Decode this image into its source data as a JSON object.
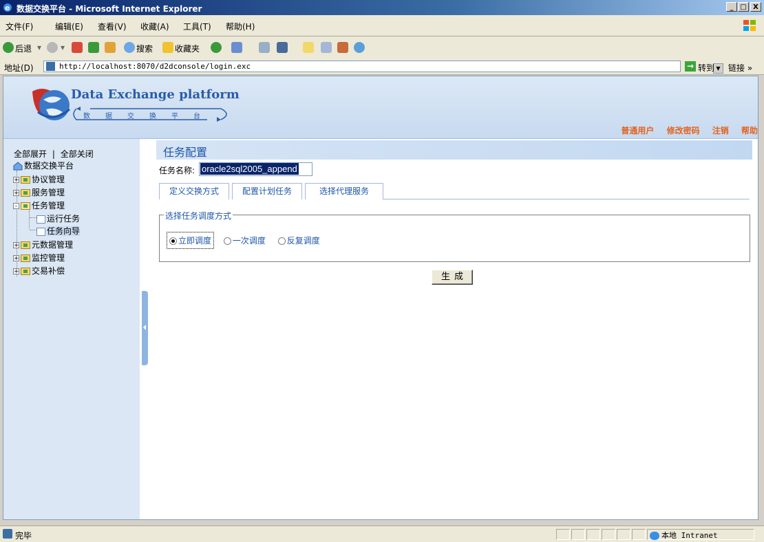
{
  "window": {
    "title": "数据交换平台 - Microsoft Internet Explorer",
    "min": "_",
    "max": "□",
    "close": "X"
  },
  "menu": [
    "文件(F)",
    "编辑(E)",
    "查看(V)",
    "收藏(A)",
    "工具(T)",
    "帮助(H)"
  ],
  "toolbar": {
    "back": "后退",
    "search": "搜索",
    "favorites": "收藏夹"
  },
  "address": {
    "label": "地址(D)",
    "url": "http://localhost:8070/d2dconsole/login.exc",
    "go": "转到",
    "links": "链接 »"
  },
  "banner": {
    "title": "Data Exchange platform",
    "subtitle": "数据交换平台"
  },
  "usernav": [
    "普通用户",
    "修改密码",
    "注销",
    "帮助"
  ],
  "tree": {
    "expand_all": "全部展开",
    "separator": "|",
    "collapse_all": "全部关闭",
    "root": "数据交换平台",
    "nodes": [
      {
        "label": "协议管理",
        "toggle": "+"
      },
      {
        "label": "服务管理",
        "toggle": "+"
      },
      {
        "label": "任务管理",
        "toggle": "-"
      },
      {
        "label": "运行任务"
      },
      {
        "label": "任务向导"
      },
      {
        "label": "元数据管理",
        "toggle": "+"
      },
      {
        "label": "监控管理",
        "toggle": "+"
      },
      {
        "label": "交易补偿",
        "toggle": "+"
      }
    ]
  },
  "main": {
    "title": "任务配置",
    "task_name_label": "任务名称:",
    "task_name_value": "oracle2sql2005_append",
    "tabs": [
      "定义交换方式",
      "配置计划任务",
      "选择代理服务"
    ],
    "schedule_legend": "选择任务调度方式",
    "schedule_options": [
      {
        "label": "立即调度",
        "selected": true
      },
      {
        "label": "一次调度",
        "selected": false
      },
      {
        "label": "反复调度",
        "selected": false
      }
    ],
    "generate_button": "生成"
  },
  "status": {
    "text": "完毕",
    "zone": "本地 Intranet"
  },
  "colors": {
    "accent": "#1e56a8",
    "usernav": "#e2641e",
    "banner": "#c8daf0"
  }
}
